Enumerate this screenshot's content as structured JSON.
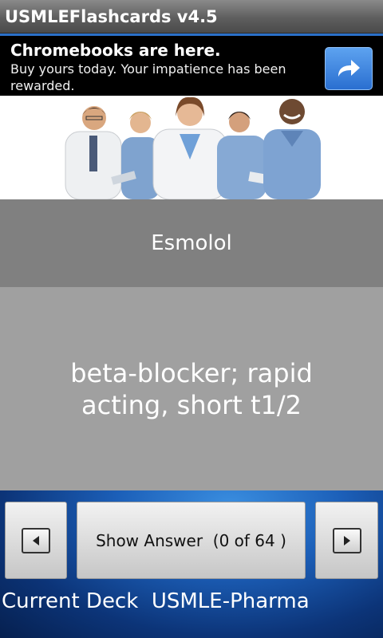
{
  "app": {
    "title": "USMLEFlashcards v4.5"
  },
  "ad": {
    "title": "Chromebooks are here.",
    "body": "Buy yours today. Your impatience has been rewarded.",
    "action_icon": "share-arrow-icon",
    "accent": "#2a6fc7"
  },
  "card": {
    "question": "Esmolol",
    "answer": "beta-blocker; rapid acting, short t1/2"
  },
  "controls": {
    "prev_icon": "triangle-left-icon",
    "next_icon": "triangle-right-icon",
    "show_answer_label": "Show Answer  (0 of 64 )"
  },
  "deck": {
    "label": "Current Deck",
    "name": "USMLE-Pharma"
  }
}
